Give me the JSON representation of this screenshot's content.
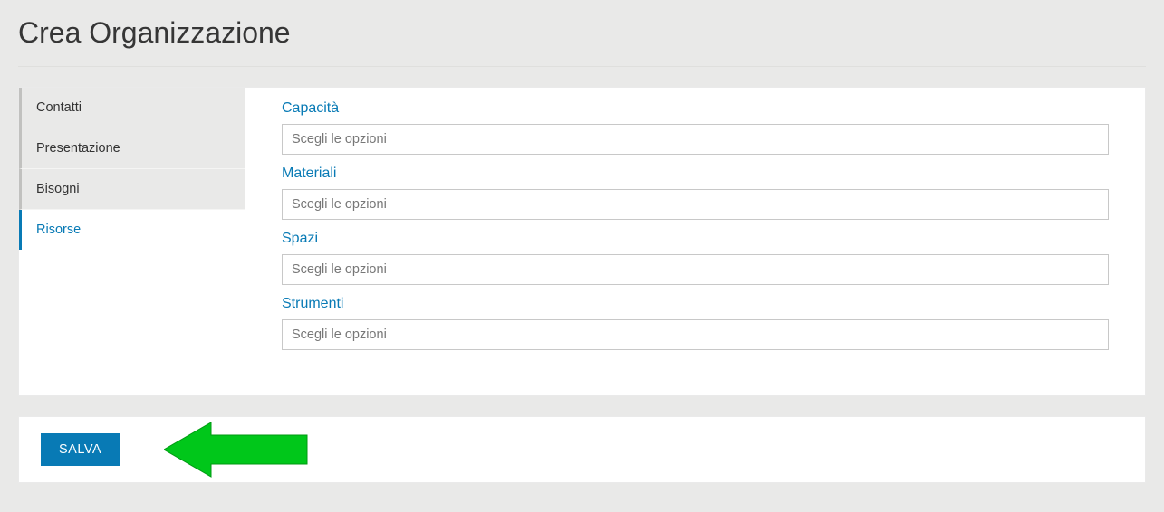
{
  "page": {
    "title": "Crea Organizzazione"
  },
  "tabs": {
    "contatti": {
      "label": "Contatti"
    },
    "presentazione": {
      "label": "Presentazione"
    },
    "bisogni": {
      "label": "Bisogni"
    },
    "risorse": {
      "label": "Risorse"
    }
  },
  "form": {
    "capacita": {
      "label": "Capacità",
      "placeholder": "Scegli le opzioni"
    },
    "materiali": {
      "label": "Materiali",
      "placeholder": "Scegli le opzioni"
    },
    "spazi": {
      "label": "Spazi",
      "placeholder": "Scegli le opzioni"
    },
    "strumenti": {
      "label": "Strumenti",
      "placeholder": "Scegli le opzioni"
    }
  },
  "buttons": {
    "save": "SALVA"
  },
  "colors": {
    "accent": "#087ab5",
    "arrow": "#00c71a"
  }
}
